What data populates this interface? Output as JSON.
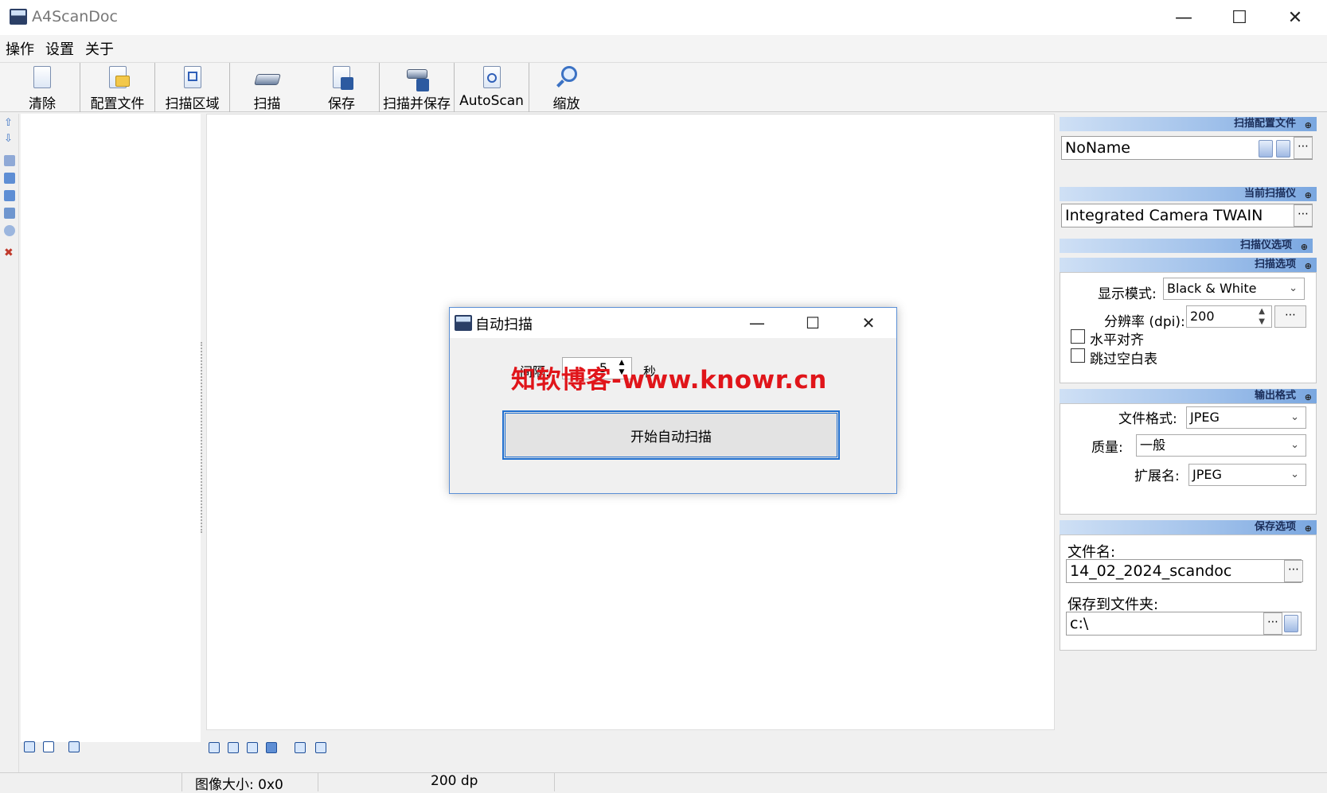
{
  "window": {
    "title": "A4ScanDoc"
  },
  "menu": [
    "操作",
    "设置",
    "关于"
  ],
  "toolbar": [
    {
      "label": "清除",
      "icon": "blank-page-icon"
    },
    {
      "label": "配置文件",
      "icon": "profile-folder-icon"
    },
    {
      "label": "扫描区域",
      "icon": "scan-area-icon"
    },
    {
      "label": "扫描",
      "icon": "scanner-icon"
    },
    {
      "label": "保存",
      "icon": "save-disk-icon"
    },
    {
      "label": "扫描并保存",
      "icon": "scan-save-icon"
    },
    {
      "label": "AutoScan",
      "icon": "autoscan-icon"
    },
    {
      "label": "缩放",
      "icon": "magnifier-icon"
    }
  ],
  "right_panel": {
    "profile": {
      "header": "扫描配置文件",
      "value": "NoName"
    },
    "scanner": {
      "header": "当前扫描仪",
      "value": "Integrated Camera TWAIN"
    },
    "scanner_options_header": "扫描仪选项",
    "scan_options": {
      "header": "扫描选项",
      "mode_label": "显示模式:",
      "mode_value": "Black & White",
      "dpi_label": "分辨率 (dpi):",
      "dpi_value": "200",
      "align_label": "水平对齐",
      "skip_blank_label": "跳过空白表"
    },
    "output": {
      "header": "输出格式",
      "format_label": "文件格式:",
      "format_value": "JPEG",
      "quality_label": "质量:",
      "quality_value": "一般",
      "ext_label": "扩展名:",
      "ext_value": "JPEG"
    },
    "save": {
      "header": "保存选项",
      "filename_label": "文件名:",
      "filename_value": "14_02_2024_scandoc",
      "folder_label": "保存到文件夹:",
      "folder_value": "c:\\"
    }
  },
  "status": {
    "image_size": "图像大小: 0x0",
    "dpi": "200 dp"
  },
  "dialog": {
    "title": "自动扫描",
    "interval_label": "间隔:",
    "interval_value": "5",
    "unit": "秒",
    "start_button": "开始自动扫描"
  },
  "watermark": "知软博客-www.knowr.cn"
}
